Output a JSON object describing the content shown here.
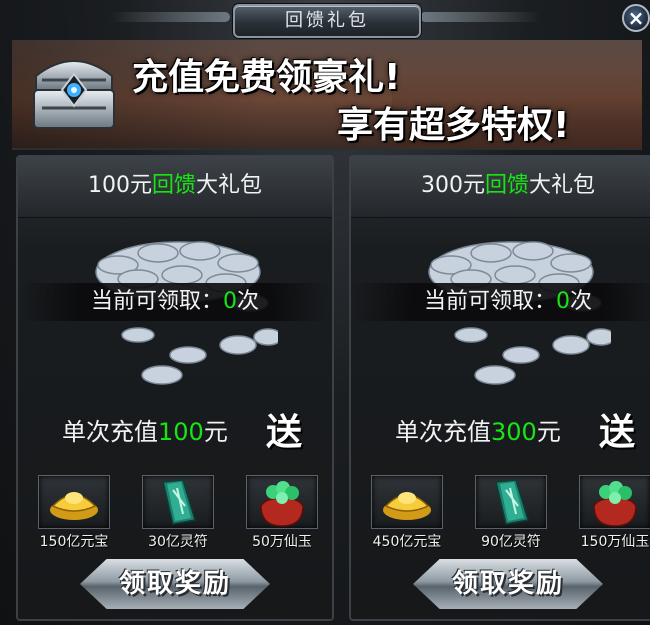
{
  "window": {
    "title": "回馈礼包",
    "close_symbol": "×"
  },
  "banner": {
    "line1": "充值免费领豪礼!",
    "line2": "享有超多特权!"
  },
  "claim_prefix": "当前可领取：",
  "claim_suffix": "次",
  "recharge_prefix": "单次充值",
  "send_label": "送",
  "packs": [
    {
      "title_prefix": "100元",
      "title_highlight": "回馈",
      "title_suffix": "大礼包",
      "claim_count": "0",
      "recharge_amount": "100",
      "recharge_unit": "元",
      "items": [
        {
          "icon": "gold-ingot-icon",
          "label": "150亿元宝"
        },
        {
          "icon": "jade-talisman-icon",
          "label": "30亿灵符"
        },
        {
          "icon": "jade-bag-icon",
          "label": "50万仙玉"
        }
      ],
      "button_label": "领取奖励"
    },
    {
      "title_prefix": "300元",
      "title_highlight": "回馈",
      "title_suffix": "大礼包",
      "claim_count": "0",
      "recharge_amount": "300",
      "recharge_unit": "元",
      "items": [
        {
          "icon": "gold-ingot-icon",
          "label": "450亿元宝"
        },
        {
          "icon": "jade-talisman-icon",
          "label": "90亿灵符"
        },
        {
          "icon": "jade-bag-icon",
          "label": "150万仙玉"
        }
      ],
      "button_label": "领取奖励"
    }
  ],
  "colors": {
    "highlight": "#18e614",
    "text": "#f3f3f3"
  }
}
